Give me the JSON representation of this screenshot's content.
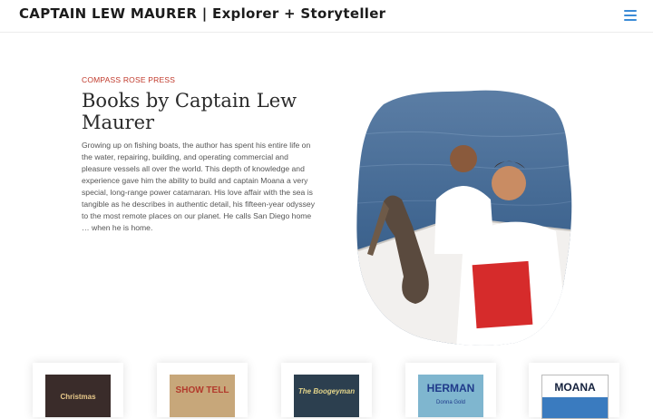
{
  "header": {
    "site_title": "CAPTAIN LEW MAURER | Explorer + Storyteller",
    "menu_icon": "hamburger-menu-icon"
  },
  "intro": {
    "eyebrow": "COMPASS ROSE PRESS",
    "heading": "Books by Captain Lew Maurer",
    "body": "Growing up on fishing boats, the author has spent his entire life on the water, repairing, building, and operating commercial and pleasure vessels all over the world. This depth of knowledge and experience gave him the ability to build and captain Moana a very special, long-range power catamaran. His love affair with the sea is tangible as he describes in authentic detail, his fifteen-year odyssey to the most remote places on our planet. He calls San Diego home … when he is home."
  },
  "colors": {
    "accent_red": "#c0392b",
    "menu_blue": "#3b8bd6"
  },
  "books": [
    {
      "cover_text": "Christmas",
      "cover_color": "#3a2c2a"
    },
    {
      "cover_text": "SHOW TELL",
      "cover_color": "#c7a77a"
    },
    {
      "cover_text": "The Boogeyman",
      "cover_color": "#2c3f4f"
    },
    {
      "cover_text": "HERMAN",
      "subtitle": "Donna Gold",
      "cover_color": "#7fb6cf"
    },
    {
      "cover_text": "MOANA",
      "cover_color": "#ffffff"
    }
  ]
}
